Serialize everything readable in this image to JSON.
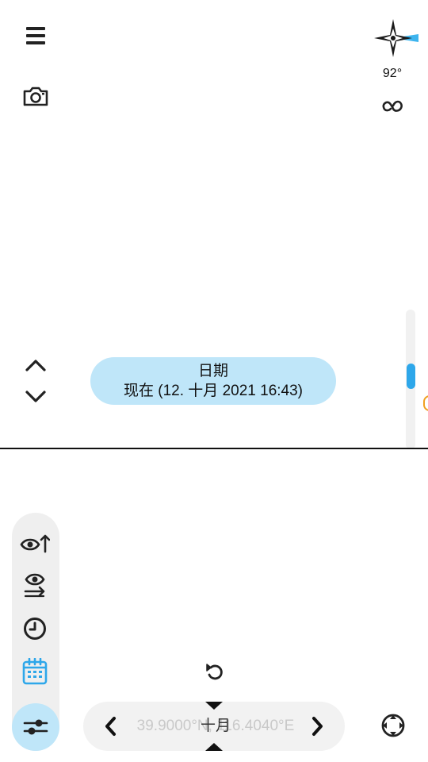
{
  "compass": {
    "heading": "92°",
    "icon": "compass-rose-icon",
    "accent": "#3db4ee"
  },
  "toolbar": {
    "menu_icon": "menu-icon",
    "camera_icon": "camera-icon",
    "link_icon": "link-icon"
  },
  "date_selector": {
    "title": "日期",
    "value": "现在 (12. 十月 2021 16:43)",
    "background": "#bfe6f9"
  },
  "coords": {
    "text": "39.9000°N, 116.4040°E",
    "overlay": "十月"
  },
  "colors": {
    "accent": "#2ea7ea",
    "highlight": "#bfe6f9",
    "warning": "#f0a020"
  }
}
